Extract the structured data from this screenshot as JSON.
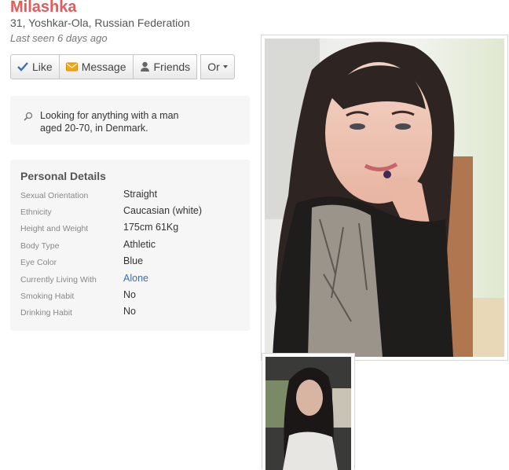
{
  "profile": {
    "name": "Milashka",
    "location": "31, Yoshkar-Ola, Russian Federation",
    "last_seen": "Last seen 6 days ago"
  },
  "actions": {
    "like": "Like",
    "message": "Message",
    "friends": "Friends",
    "or": "Or"
  },
  "looking_for": "Looking for anything with a man aged 20-70, in Denmark.",
  "details": {
    "title": "Personal Details",
    "rows": [
      {
        "label": "Sexual Orientation",
        "value": "Straight"
      },
      {
        "label": "Ethnicity",
        "value": "Caucasian (white)"
      },
      {
        "label": "Height and Weight",
        "value": "175cm 61Kg"
      },
      {
        "label": "Body Type",
        "value": "Athletic"
      },
      {
        "label": "Eye Color",
        "value": "Blue"
      },
      {
        "label": "Currently Living With",
        "value": "Alone"
      },
      {
        "label": "Smoking Habit",
        "value": "No"
      },
      {
        "label": "Drinking Habit",
        "value": "No"
      }
    ]
  },
  "colors": {
    "name": "#e8595a",
    "link": "#3d6cb4",
    "panel_bg": "#f6f6f6"
  },
  "icons": {
    "like": "check-icon",
    "message": "message-icon",
    "friends": "friends-icon",
    "looking": "search-icon"
  }
}
